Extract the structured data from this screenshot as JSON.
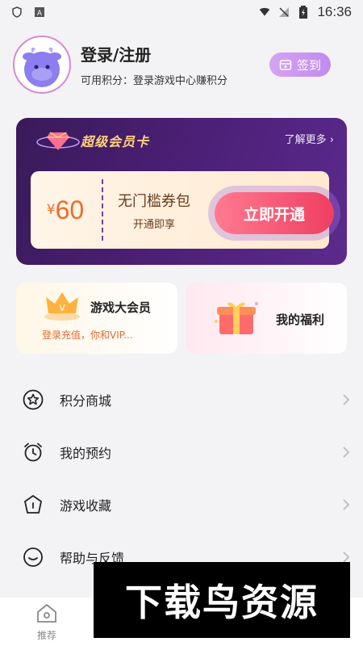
{
  "status_bar": {
    "time": "16:36"
  },
  "profile": {
    "title": "登录/注册",
    "points": "可用积分：登录游戏中心赚积分",
    "checkin_label": "签到"
  },
  "vip_card": {
    "title": "超级会员卡",
    "more": "了解更多",
    "coupon": {
      "currency": "¥",
      "amount": "60",
      "name": "无门槛券包",
      "sub": "开通即享"
    },
    "open_label": "立即开通"
  },
  "promos": {
    "vip_title": "游戏大会员",
    "vip_sub": "登录充值，你和VIP...",
    "welfare_title": "我的福利"
  },
  "menu": [
    {
      "label": "积分商城",
      "icon": "star-icon"
    },
    {
      "label": "我的预约",
      "icon": "alarm-clock-icon"
    },
    {
      "label": "游戏收藏",
      "icon": "bookmark-star-icon"
    },
    {
      "label": "帮助与反馈",
      "icon": "smile-chat-icon"
    }
  ],
  "bottom_nav": {
    "home_label": "推荐"
  },
  "watermark": {
    "text": "下载鸟资源"
  },
  "colors": {
    "vip_bg": "#3a1a5a",
    "gold_text": "#ffd27a",
    "open_button": "#ef3f61",
    "checkin_button": "#c08bef",
    "coupon_price": "#f06b2b"
  }
}
